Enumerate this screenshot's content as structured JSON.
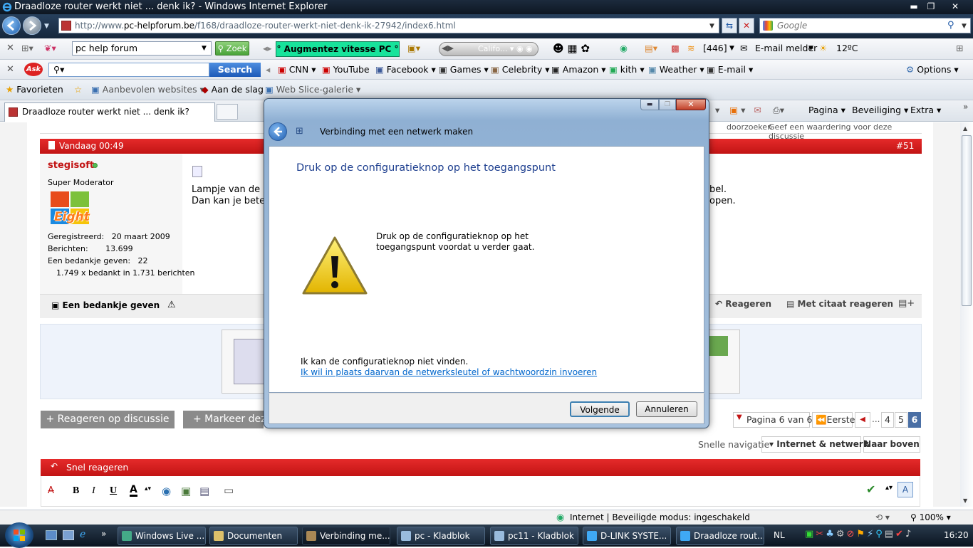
{
  "window": {
    "title": "Draadloze router werkt niet ... denk ik? - Windows Internet Explorer"
  },
  "address": {
    "prefix": "http://www.",
    "host": "pc-helpforum.be",
    "path": "/f168/draadloze-router-werkt-niet-denk-ik-27942/index6.html"
  },
  "search_box": {
    "placeholder": "Google"
  },
  "toolbar1": {
    "search_value": "pc help forum",
    "zoek_label": "Zoek",
    "boost_label": "° Augmentez vitesse PC °",
    "media_label": "Califo...",
    "count_label": "[446]",
    "email_label": "E-mail melder",
    "temp_label": "12ºC"
  },
  "toolbar2": {
    "search_button": "Search",
    "links": [
      "CNN",
      "YouTube",
      "Facebook",
      "Games",
      "Celebrity",
      "Amazon",
      "kith",
      "Weather",
      "E-mail"
    ],
    "options_label": "Options"
  },
  "favbar": {
    "favorites_label": "Favorieten",
    "recommended_label": "Aanbevolen websites",
    "getstarted_label": "Aan de slag",
    "webslice_label": "Web Slice-galerie"
  },
  "tab": {
    "title": "Draadloze router werkt niet ... denk ik?"
  },
  "commandbar": {
    "page_label": "Pagina",
    "security_label": "Beveiliging",
    "extra_label": "Extra"
  },
  "forum": {
    "search_in_thread": "doorzoeken",
    "rate_thread": "Geef een waardering voor deze discussie",
    "post_date": "Vandaag 00:49",
    "post_number": "#51",
    "username": "stegisoft",
    "user_title": "Super Moderator",
    "avatar_text": "Eight",
    "registered_label": "Geregistreerd:",
    "registered_value": "20 maart 2009",
    "posts_label": "Berichten:",
    "posts_value": "13.699",
    "thanks_label": "Een bedankje geven:",
    "thanks_value": "22",
    "thanked_text": "1.749 x bedankt in 1.731 berichten",
    "post_line1_left": "Lampje van de",
    "post_line1_right": "bel.",
    "post_line2_left": "Dan kan je bete",
    "post_line2_right": "open.",
    "thank_button": "Een bedankje geven",
    "reply_label": "Reageren",
    "quote_reply_label": "Met citaat reageren",
    "reply_thread_button": "+ Reageren op discussie",
    "mark_button": "+ Markeer deze",
    "pagination_label": "Pagina 6 van 6",
    "first_label": "Eerste",
    "pages": [
      "4",
      "5",
      "6"
    ],
    "quick_nav_label": "Snelle navigatie",
    "category_label": "Internet & netwerk",
    "top_label": "Naar boven",
    "quick_reply_label": "Snel reageren"
  },
  "dialog": {
    "title": "Verbinding met een netwerk maken",
    "heading": "Druk op de configuratieknop op het toegangspunt",
    "message_line1": "Druk op de configuratieknop op het",
    "message_line2": "toegangspunt voordat u verder gaat.",
    "cannot_find": "Ik kan de configuratieknop niet vinden.",
    "alt_link": "Ik wil in plaats daarvan de netwerksleutel of wachtwoordzin invoeren",
    "next_button": "Volgende",
    "cancel_button": "Annuleren"
  },
  "statusbar": {
    "zone_label": "Internet | Beveiligde modus: ingeschakeld",
    "zoom": "100%"
  },
  "taskbar": {
    "tasks": [
      "Windows Live ...",
      "Documenten",
      "Verbinding me...",
      "pc - Kladblok",
      "pc11 - Kladblok",
      "D-LINK SYSTE...",
      "Draadloze rout..."
    ],
    "language": "NL",
    "clock": "16:20"
  },
  "colors": {
    "forum_red": "#d21a1a",
    "link_blue": "#0066cc",
    "dialog_heading": "#1e3f8f",
    "boost_green": "#17e39b"
  }
}
